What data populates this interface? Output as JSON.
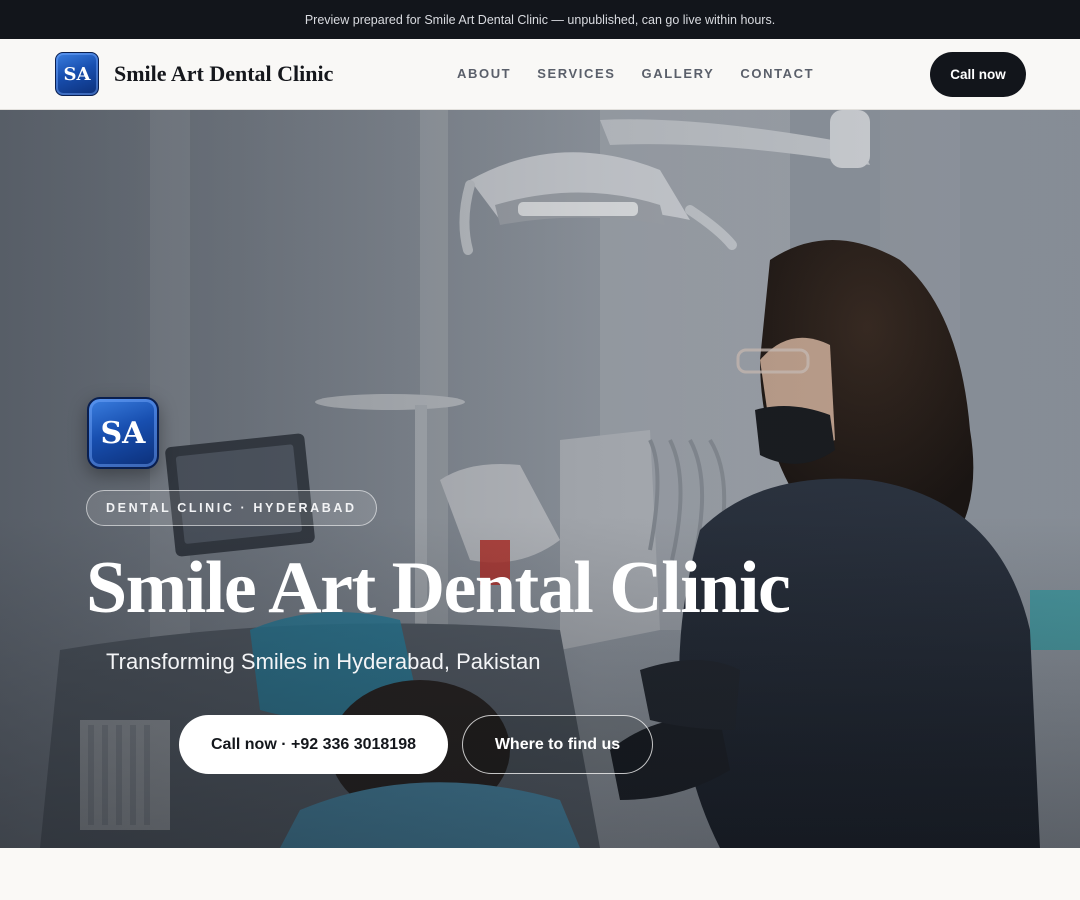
{
  "preview_banner": "Preview prepared for Smile Art Dental Clinic — unpublished, can go live within hours.",
  "header": {
    "logo_text": "SA",
    "brand_name": "Smile Art Dental Clinic",
    "nav": [
      "ABOUT",
      "SERVICES",
      "GALLERY",
      "CONTACT"
    ],
    "cta_label": "Call now"
  },
  "hero": {
    "logo_text": "SA",
    "eyebrow": "DENTAL CLINIC · HYDERABAD",
    "title": "Smile Art Dental Clinic",
    "subtitle": "Transforming Smiles in Hyderabad, Pakistan",
    "primary_button": "Call now · +92 336 3018198",
    "secondary_button": "Where to find us"
  },
  "colors": {
    "dark": "#12151b",
    "logo_blue": "#184fb0",
    "page_bg": "#faf9f6"
  }
}
